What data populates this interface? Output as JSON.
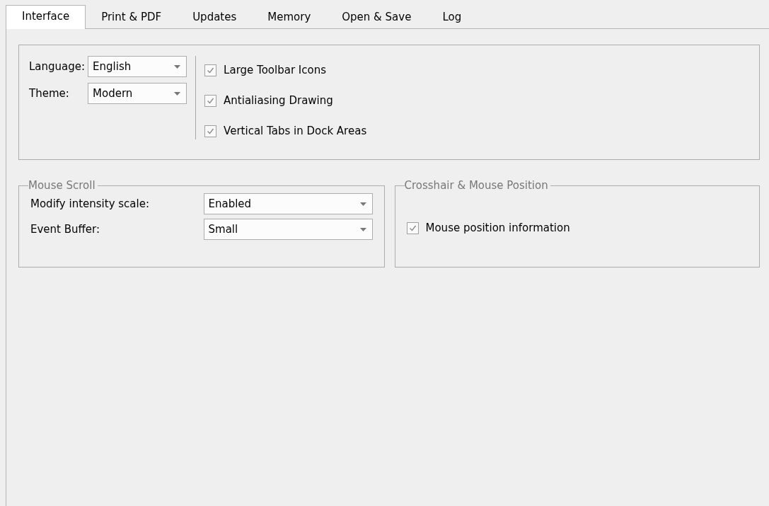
{
  "tabs": [
    {
      "label": "Interface",
      "selected": true
    },
    {
      "label": "Print & PDF",
      "selected": false
    },
    {
      "label": "Updates",
      "selected": false
    },
    {
      "label": "Memory",
      "selected": false
    },
    {
      "label": "Open & Save",
      "selected": false
    },
    {
      "label": "Log",
      "selected": false
    }
  ],
  "general": {
    "fields": [
      {
        "label": "Language:",
        "value": "English"
      },
      {
        "label": "Theme:",
        "value": "Modern"
      }
    ],
    "options": [
      {
        "label": "Large Toolbar Icons",
        "checked": true
      },
      {
        "label": "Antialiasing Drawing",
        "checked": true
      },
      {
        "label": "Vertical Tabs in Dock Areas",
        "checked": true
      }
    ]
  },
  "mouse_scroll": {
    "title": "Mouse Scroll",
    "fields": [
      {
        "label": "Modify intensity scale:",
        "value": "Enabled"
      },
      {
        "label": "Event Buffer:",
        "value": "Small"
      }
    ]
  },
  "crosshair": {
    "title": "Crosshair & Mouse Position",
    "options": [
      {
        "label": "Mouse position information",
        "checked": true
      }
    ]
  }
}
